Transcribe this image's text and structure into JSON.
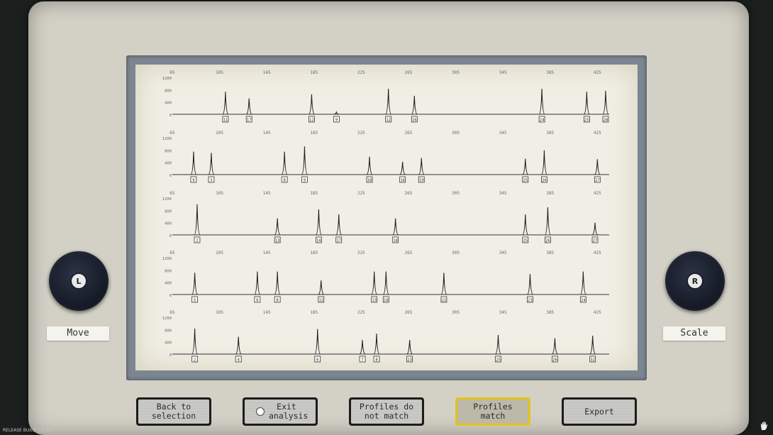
{
  "axis": {
    "bp_ticks": [
      65,
      105,
      145,
      185,
      225,
      265,
      305,
      345,
      385,
      425
    ],
    "y_ticks": [
      1200,
      800,
      400,
      0
    ]
  },
  "profiles": [
    {
      "peaks": [
        {
          "x": 110,
          "h": 0.88,
          "label": "11"
        },
        {
          "x": 130,
          "h": 0.62,
          "label": "17"
        },
        {
          "x": 183,
          "h": 0.78,
          "label": "12"
        },
        {
          "x": 204,
          "h": 0.0,
          "label": "9"
        },
        {
          "x": 248,
          "h": 1.0,
          "label": "12"
        },
        {
          "x": 270,
          "h": 0.72,
          "label": "16"
        },
        {
          "x": 378,
          "h": 1.0,
          "label": "24"
        },
        {
          "x": 416,
          "h": 0.88,
          "label": "25"
        },
        {
          "x": 432,
          "h": 0.92,
          "label": "28"
        }
      ]
    },
    {
      "peaks": [
        {
          "x": 83,
          "h": 0.9,
          "label": "9"
        },
        {
          "x": 98,
          "h": 0.85,
          "label": "3"
        },
        {
          "x": 160,
          "h": 0.9,
          "label": "8"
        },
        {
          "x": 177,
          "h": 1.1,
          "label": "9"
        },
        {
          "x": 232,
          "h": 0.7,
          "label": "18"
        },
        {
          "x": 260,
          "h": 0.5,
          "label": "16"
        },
        {
          "x": 276,
          "h": 0.65,
          "label": "19"
        },
        {
          "x": 364,
          "h": 0.62,
          "label": "25"
        },
        {
          "x": 380,
          "h": 0.95,
          "label": "26"
        },
        {
          "x": 425,
          "h": 0.6,
          "label": "27"
        }
      ]
    },
    {
      "peaks": [
        {
          "x": 86,
          "h": 1.2,
          "label": "2"
        },
        {
          "x": 154,
          "h": 0.65,
          "label": "13"
        },
        {
          "x": 189,
          "h": 1.0,
          "label": "14"
        },
        {
          "x": 206,
          "h": 0.8,
          "label": "17"
        },
        {
          "x": 254,
          "h": 0.65,
          "label": "18"
        },
        {
          "x": 364,
          "h": 0.8,
          "label": "25"
        },
        {
          "x": 383,
          "h": 1.08,
          "label": "26"
        },
        {
          "x": 423,
          "h": 0.48,
          "label": "27"
        }
      ]
    },
    {
      "peaks": [
        {
          "x": 84,
          "h": 0.85,
          "label": "5"
        },
        {
          "x": 137,
          "h": 0.9,
          "label": "6"
        },
        {
          "x": 154,
          "h": 0.9,
          "label": "8"
        },
        {
          "x": 191,
          "h": 0.55,
          "label": "12"
        },
        {
          "x": 236,
          "h": 0.9,
          "label": "13"
        },
        {
          "x": 246,
          "h": 0.9,
          "label": "18"
        },
        {
          "x": 295,
          "h": 0.85,
          "label": "22"
        },
        {
          "x": 368,
          "h": 0.8,
          "label": "23"
        },
        {
          "x": 413,
          "h": 0.9,
          "label": "24"
        }
      ]
    },
    {
      "peaks": [
        {
          "x": 84,
          "h": 1.0,
          "label": "2"
        },
        {
          "x": 121,
          "h": 0.68,
          "label": "4"
        },
        {
          "x": 188,
          "h": 0.98,
          "label": "6"
        },
        {
          "x": 226,
          "h": 0.55,
          "label": "7"
        },
        {
          "x": 238,
          "h": 0.8,
          "label": "8"
        },
        {
          "x": 266,
          "h": 0.55,
          "label": "23"
        },
        {
          "x": 341,
          "h": 0.75,
          "label": "25"
        },
        {
          "x": 389,
          "h": 0.62,
          "label": "26"
        },
        {
          "x": 421,
          "h": 0.72,
          "label": "32"
        }
      ]
    }
  ],
  "controls": {
    "move_label": "Move",
    "scale_label": "Scale",
    "left_knob_letter": "L",
    "right_knob_letter": "R"
  },
  "buttons": {
    "back": "Back to selection",
    "exit": "Exit analysis",
    "no_match": "Profiles do not match",
    "match": "Profiles match",
    "export": "Export"
  },
  "footer": {
    "build": "RELEASE  BUILD 1.0.29"
  },
  "icons": {
    "exit_circle": "circle-icon",
    "hand": "hand-icon"
  },
  "colors": {
    "selected_border": "#e7c21a",
    "paper": "#f1efe5",
    "trace": "#333333"
  }
}
